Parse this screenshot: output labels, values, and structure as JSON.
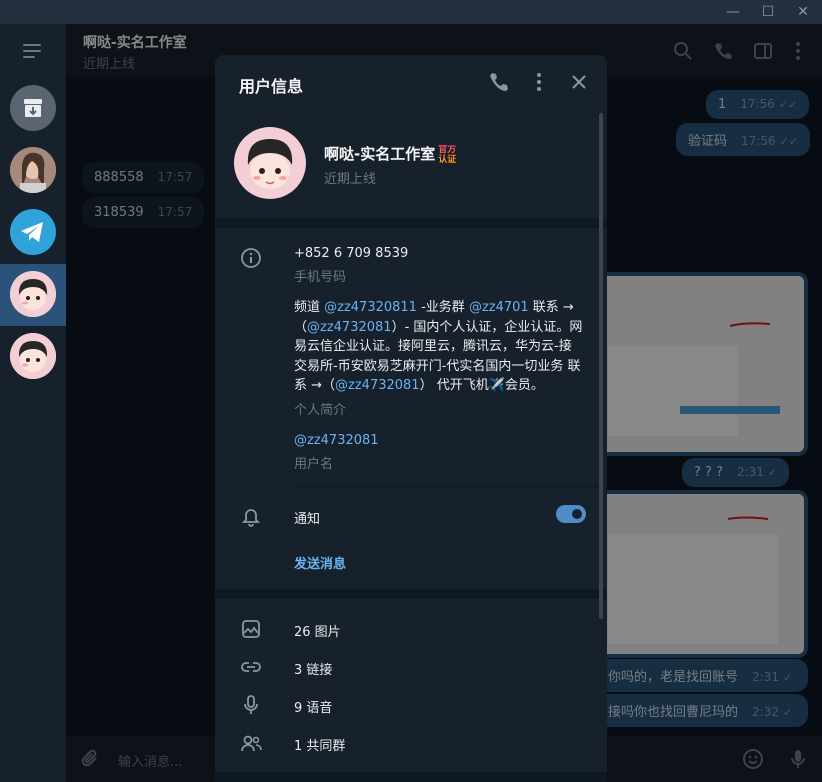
{
  "window": {
    "minimize": "—",
    "maximize": "☐",
    "close": "✕"
  },
  "chat": {
    "title": "啊哒-实名工作室",
    "badge": "官方认证",
    "status": "近期上线"
  },
  "messages_in": [
    {
      "text": "888558",
      "time": "17:57"
    },
    {
      "text": "318539",
      "time": "17:57"
    }
  ],
  "messages_out": [
    {
      "text": "1",
      "time": "17:56"
    },
    {
      "text": "验证码",
      "time": "17:56"
    },
    {
      "text": "? ? ?",
      "time": "2:31"
    },
    {
      "text": "你吗的，老是找回账号",
      "time": "2:31"
    },
    {
      "text": "接吗你也找回曹尼玛的",
      "time": "2:32"
    }
  ],
  "input": {
    "placeholder": "输入消息..."
  },
  "panel": {
    "title": "用户信息",
    "name": "啊哒-实名工作室",
    "badge_top": "官方",
    "badge_bottom": "认证",
    "status": "近期上线",
    "phone": "+852 6 709 8539",
    "phone_label": "手机号码",
    "bio_parts": {
      "p1": "频道 ",
      "l1": "@zz47320811",
      "p2": " -业务群 ",
      "l2": "@zz4701",
      "p3": " 联系 →（",
      "l3": "@zz4732081",
      "p4": "）- 国内个人认证，企业认证。网易云信企业认证。接阿里云，腾讯云，华为云-接交易所-币安欧易芝麻开门-代实名国内一切业务 联系 →（",
      "l4": "@zz4732081",
      "p5": "） 代开飞机✈️会员。"
    },
    "bio_label": "个人简介",
    "username": "@zz4732081",
    "username_label": "用户名",
    "notifications": "通知",
    "notifications_on": true,
    "send_message": "发送消息",
    "media": [
      {
        "label": "26 图片",
        "icon": "photo-icon"
      },
      {
        "label": "3 链接",
        "icon": "link-icon"
      },
      {
        "label": "9 语音",
        "icon": "microphone-icon"
      },
      {
        "label": "1 共同群",
        "icon": "group-icon"
      }
    ]
  },
  "colors": {
    "accent": "#6ab2f2",
    "active": "#2b5278",
    "panel": "#17212b"
  }
}
